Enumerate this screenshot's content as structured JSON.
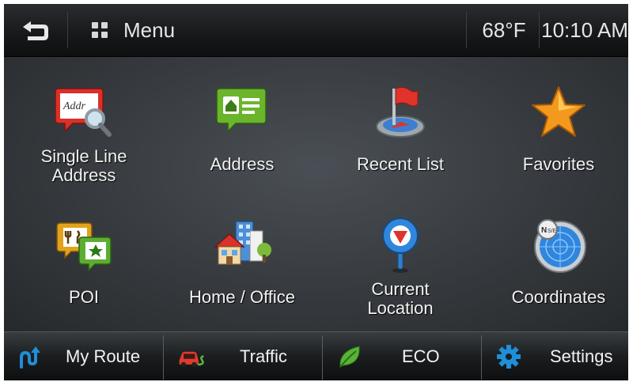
{
  "topbar": {
    "back_icon": "back-arrow-icon",
    "menu_icon": "grid-icon",
    "menu_label": "Menu",
    "temperature": "68°F",
    "time": "10:10 AM"
  },
  "tiles": [
    {
      "label_line1": "Single Line",
      "label_line2": "Address",
      "icon": "address-card-search-icon"
    },
    {
      "label": "Address",
      "icon": "home-address-icon"
    },
    {
      "label": "Recent List",
      "icon": "flag-compass-icon"
    },
    {
      "label": "Favorites",
      "icon": "star-icon"
    },
    {
      "label": "POI",
      "icon": "poi-icon"
    },
    {
      "label": "Home / Office",
      "icon": "buildings-icon"
    },
    {
      "label_line1": "Current",
      "label_line2": "Location",
      "icon": "location-pin-icon"
    },
    {
      "label": "Coordinates",
      "icon": "coordinates-radar-icon"
    }
  ],
  "bottombar": [
    {
      "label": "My Route",
      "icon": "route-icon"
    },
    {
      "label": "Traffic",
      "icon": "traffic-car-icon"
    },
    {
      "label": "ECO",
      "icon": "leaf-icon"
    },
    {
      "label": "Settings",
      "icon": "gear-icon"
    }
  ],
  "colors": {
    "accent_blue": "#1e8fd8",
    "traffic_red": "#e23a2e",
    "eco_green": "#58b33a",
    "star_orange": "#f39a1e"
  }
}
